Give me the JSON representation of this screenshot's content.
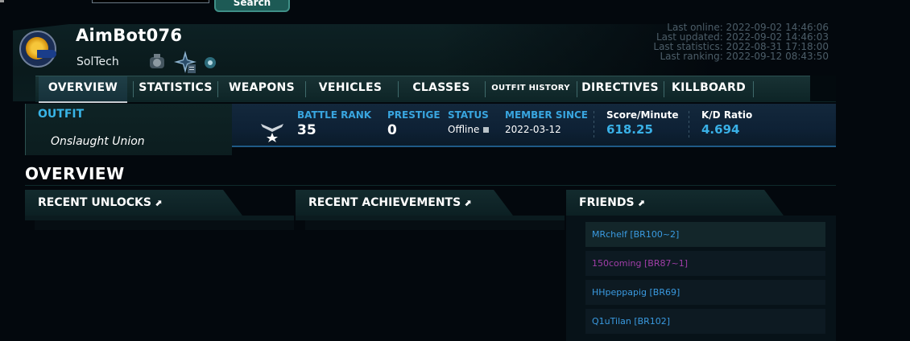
{
  "search": {
    "button_label": "Search"
  },
  "player": {
    "name": "AimBot076",
    "faction": "SolTech"
  },
  "last": {
    "online": "Last online: 2022-09-02 14:46:06",
    "updated": "Last updated: 2022-09-02 14:46:03",
    "statistics": "Last statistics: 2022-08-31 17:18:00",
    "ranking": "Last ranking: 2022-09-12 08:43:50"
  },
  "tabs": [
    "OVERVIEW",
    "STATISTICS",
    "WEAPONS",
    "VEHICLES",
    "CLASSES",
    "OUTFIT HISTORY",
    "DIRECTIVES",
    "KILLBOARD"
  ],
  "outfit": {
    "title": "OUTFIT",
    "name": "Onslaught Union"
  },
  "stats": {
    "battle_rank_label": "BATTLE RANK",
    "battle_rank": "35",
    "prestige_label": "PRESTIGE",
    "prestige": "0",
    "status_label": "STATUS",
    "status": "Offline",
    "member_since_label": "MEMBER SINCE",
    "member_since": "2022-03-12",
    "spm_label": "Score/Minute",
    "spm": "618.25",
    "kd_label": "K/D Ratio",
    "kd": "4.694"
  },
  "overview": {
    "title": "OVERVIEW",
    "recent_unlocks": "RECENT UNLOCKS",
    "recent_achievements": "RECENT ACHIEVEMENTS",
    "friends_title": "FRIENDS"
  },
  "friends": [
    {
      "label": "MRchelf [BR100~2]",
      "color": "#3a9ae0",
      "bg": "#13262a"
    },
    {
      "label": "150coming [BR87~1]",
      "color": "#a13ea8",
      "bg": "#0d1a22"
    },
    {
      "label": "HHpeppapig [BR69]",
      "color": "#3a9ae0",
      "bg": "#0d1a22"
    },
    {
      "label": "Q1uTilan [BR102]",
      "color": "#3a9ae0",
      "bg": "#0d1a22"
    }
  ],
  "colors": {
    "accent": "#39b4e6",
    "background": "#03080d",
    "panel": "#0d2124"
  }
}
